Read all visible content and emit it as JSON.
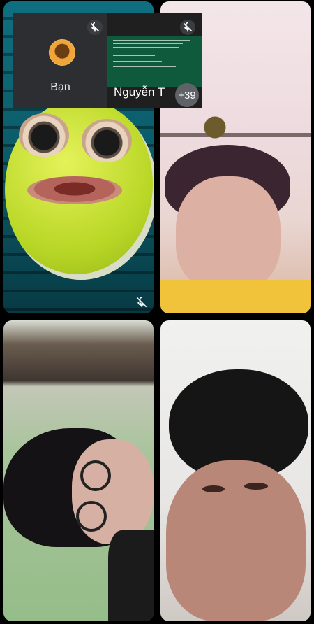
{
  "participants": [
    {
      "name": "Bạn",
      "muted": true
    },
    {
      "name": "Nguyễn T",
      "muted": true,
      "presenting": true
    }
  ],
  "overflow_badge": "+39",
  "icons": {
    "mic_off": "mic-off-icon",
    "self_avatar": "avatar-icon"
  },
  "colors": {
    "panel_bg": "#202124",
    "badge_bg": "#5f6368"
  }
}
